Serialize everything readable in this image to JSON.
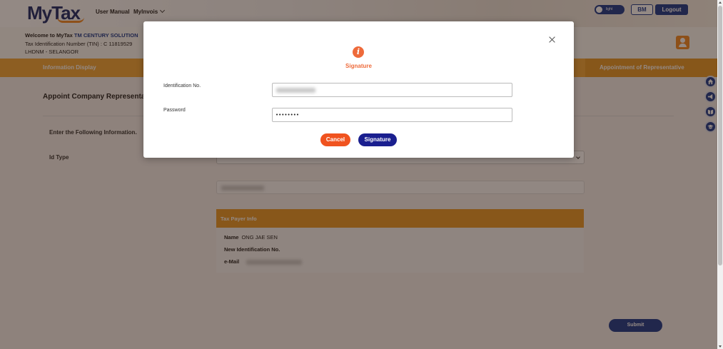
{
  "header": {
    "logo_my": "My",
    "logo_tax": "Tax",
    "nav_user_manual": "User Manual",
    "nav_myinvois": "MyInvois",
    "toggle_label": "light",
    "btn_language": "BM",
    "btn_logout": "Logout"
  },
  "infobar": {
    "welcome_prefix": "Welcome to MyTax",
    "company": "TM CENTURY SOLUTION",
    "tin_line": "Tax Identification Number (TIN) : C 11819529",
    "office_line": "LHDNM - SELANGOR"
  },
  "tabs": {
    "information_display": "Information Display",
    "appointment": "Appointment of Representative"
  },
  "page": {
    "title": "Appoint Company Representa",
    "section_label": "Enter the Following Information.",
    "id_type_label": "Id Type",
    "taxpayer_info_title": "Tax Payer Info",
    "name_label": "Name",
    "name_value": "ONG JAE SEN",
    "new_id_label": "New Identification No.",
    "email_label": "e-Mail",
    "submit": "Submit"
  },
  "modal": {
    "title": "Signature",
    "id_label": "Identification No.",
    "password_label": "Password",
    "password_value": "••••••••",
    "cancel": "Cancel",
    "signature": "Signature"
  },
  "colors": {
    "brand_blue": "#1a3a8f",
    "brand_orange": "#f2a93b",
    "accent_red": "#f0531f",
    "info_orange": "#ee6a3a"
  },
  "icons": {
    "side": [
      "home-icon",
      "megaphone-icon",
      "book-icon",
      "graduation-cap-icon"
    ],
    "modal_info": "info-icon",
    "close": "close-icon",
    "user": "user-icon"
  }
}
